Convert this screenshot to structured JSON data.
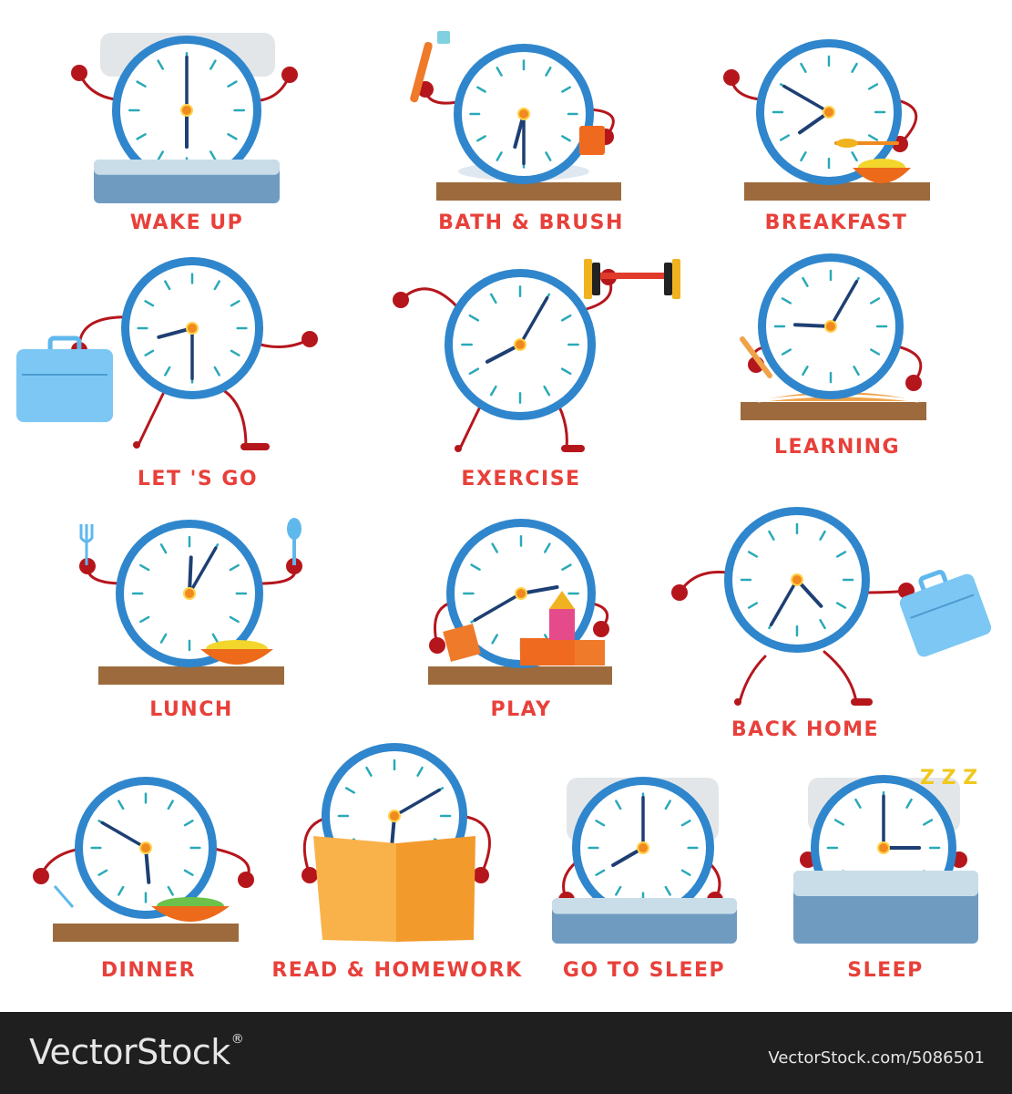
{
  "activities": [
    {
      "label": "WAKE UP",
      "hour": 6,
      "minute": 0
    },
    {
      "label": "BATH & BRUSH",
      "hour": 6,
      "minute": 30
    },
    {
      "label": "BREAKFAST",
      "hour": 7,
      "minute": 50
    },
    {
      "label": "LET 'S GO",
      "hour": 8,
      "minute": 30
    },
    {
      "label": "EXERCISE",
      "hour": 8,
      "minute": 5
    },
    {
      "label": "LEARNING",
      "hour": 9,
      "minute": 5
    },
    {
      "label": "LUNCH",
      "hour": 12,
      "minute": 5
    },
    {
      "label": "PLAY",
      "hour": 2,
      "minute": 40
    },
    {
      "label": "BACK HOME",
      "hour": 4,
      "minute": 35
    },
    {
      "label": "DINNER",
      "hour": 5,
      "minute": 50
    },
    {
      "label": "READ & HOMEWORK",
      "hour": 6,
      "minute": 10
    },
    {
      "label": "GO TO SLEEP",
      "hour": 8,
      "minute": 0
    },
    {
      "label": "SLEEP",
      "hour": 3,
      "minute": 0
    }
  ],
  "zzz": "Z Z Z",
  "footer": {
    "brand": "VectorStock",
    "reg": "®",
    "credit": "VectorStock.com/5086501"
  },
  "colors": {
    "clock_ring": "#2f86cc",
    "clock_face": "#ffffff",
    "hands": "#1e3f73",
    "ticks": "#2aa9b8",
    "hub": "#f08a1e",
    "limbs": "#b5161c",
    "label": "#e8403a",
    "footer_bg": "#1f1f1f"
  },
  "props": [
    "pillow-icon",
    "bed-icon",
    "toothbrush-icon",
    "mug-icon",
    "bowl-icon",
    "spoon-icon",
    "briefcase-icon",
    "dumbbell-icon",
    "book-icon",
    "pencil-icon",
    "fork-icon",
    "block-toys-icon",
    "zzz-icon"
  ]
}
